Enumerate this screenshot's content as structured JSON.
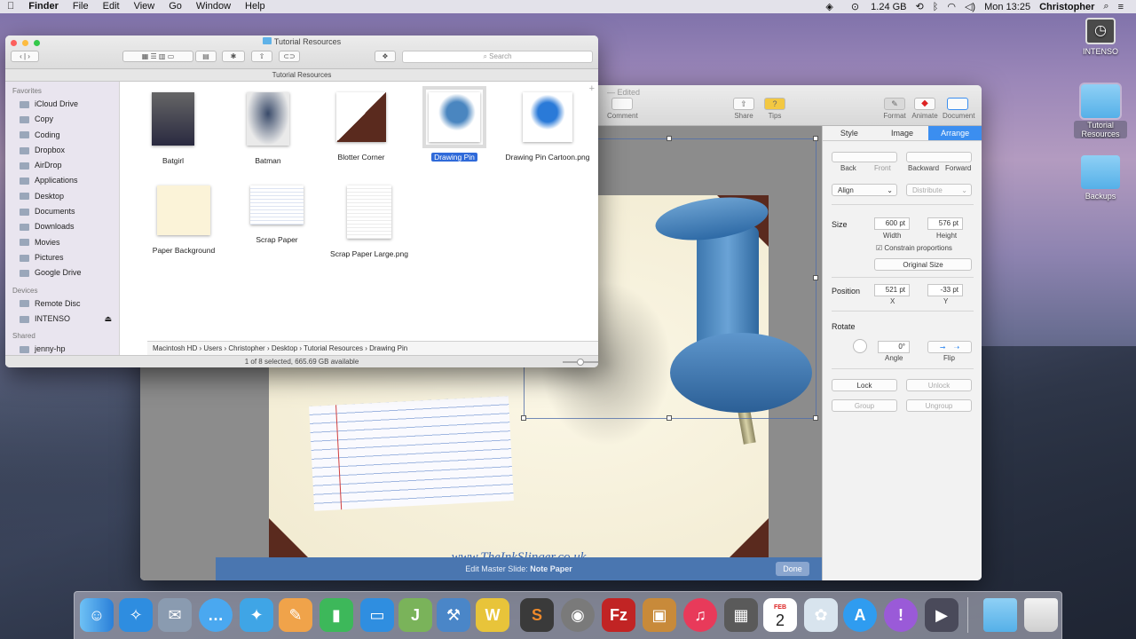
{
  "menubar": {
    "apple": "",
    "app": "Finder",
    "items": [
      "File",
      "Edit",
      "View",
      "Go",
      "Window",
      "Help"
    ],
    "memory": "1.24 GB",
    "clock": "Mon 13:25",
    "user": "Christopher"
  },
  "desktop": {
    "icons": [
      {
        "label": "INTENSO"
      },
      {
        "label": "Tutorial Resources"
      },
      {
        "label": "Backups"
      }
    ]
  },
  "keynote": {
    "edited": "— Edited",
    "toolbar": {
      "comment": "Comment",
      "share": "Share",
      "tips": "Tips",
      "format": "Format",
      "animate": "Animate",
      "document": "Document"
    },
    "slide": {
      "watermark": "www.TheInkSlinger.co.uk"
    },
    "master_bar": {
      "label": "Edit Master Slide:",
      "name": "Note Paper",
      "done": "Done"
    },
    "inspector": {
      "tabs": [
        "Style",
        "Image",
        "Arrange"
      ],
      "active_tab": "Arrange",
      "layer_buttons": [
        "Back",
        "Front",
        "Backward",
        "Forward"
      ],
      "align": "Align",
      "distribute": "Distribute",
      "size_label": "Size",
      "width": "600 pt",
      "height": "576 pt",
      "width_label": "Width",
      "height_label": "Height",
      "constrain": "Constrain proportions",
      "original_size": "Original Size",
      "position_label": "Position",
      "x": "521 pt",
      "y": "-33 pt",
      "x_label": "X",
      "y_label": "Y",
      "rotate_label": "Rotate",
      "angle": "0°",
      "angle_label": "Angle",
      "flip_label": "Flip",
      "lock": "Lock",
      "unlock": "Unlock",
      "group": "Group",
      "ungroup": "Ungroup"
    }
  },
  "finder": {
    "title": "Tutorial Resources",
    "path_title": "Tutorial Resources",
    "search_placeholder": "Search",
    "sidebar": {
      "favorites_header": "Favorites",
      "favorites": [
        "iCloud Drive",
        "Copy",
        "Coding",
        "Dropbox",
        "AirDrop",
        "Applications",
        "Desktop",
        "Documents",
        "Downloads",
        "Movies",
        "Pictures",
        "Google Drive"
      ],
      "devices_header": "Devices",
      "devices": [
        "Remote Disc",
        "INTENSO"
      ],
      "shared_header": "Shared",
      "shared": [
        "jenny-hp"
      ]
    },
    "files": [
      {
        "name": "Batgirl"
      },
      {
        "name": "Batman"
      },
      {
        "name": "Blotter Corner"
      },
      {
        "name": "Drawing Pin",
        "selected": true
      },
      {
        "name": "Drawing Pin Cartoon.png"
      },
      {
        "name": "Paper Background"
      },
      {
        "name": "Scrap Paper"
      },
      {
        "name": "Scrap Paper Large.png"
      }
    ],
    "breadcrumb": [
      "Macintosh HD",
      "Users",
      "Christopher",
      "Desktop",
      "Tutorial Resources",
      "Drawing Pin"
    ],
    "status": "1 of 8 selected, 665.69 GB available"
  },
  "dock": {
    "apps": [
      "finder-icon",
      "safari-icon",
      "mail-icon",
      "messages-icon",
      "twitter-icon",
      "pages-icon",
      "numbers-icon",
      "keynote-icon",
      "coda-icon",
      "xcode-icon",
      "textwrangler-icon",
      "sublime-icon",
      "sequel-icon",
      "filezilla-icon",
      "preview-icon",
      "itunes-icon",
      "calculator-icon",
      "calendar-icon",
      "photos-icon",
      "appstore-icon",
      "instastats-icon",
      "photobooth-icon",
      "downloads-folder-icon",
      "trash-icon"
    ],
    "calendar_month": "FEB",
    "calendar_day": "2"
  }
}
